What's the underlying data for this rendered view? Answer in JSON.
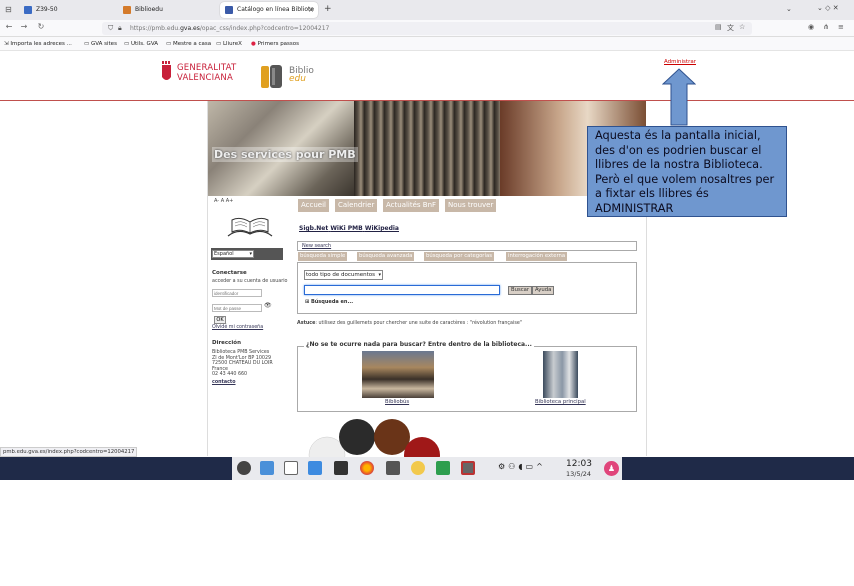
{
  "browser": {
    "tabs": [
      {
        "label": "Z39-50",
        "favicon_color": "#3a6bc4"
      },
      {
        "label": "Biblioedu",
        "favicon_color": "#d47a2a"
      },
      {
        "label": "Catálogo en línea Bibliote",
        "favicon_color": "#3a5aa8"
      }
    ],
    "new_tab": "+",
    "url_prefix": "https://pmb.edu.",
    "url_domain": "gva.es",
    "url_suffix": "/opac_css/index.php?codcentro=12004217",
    "bookmarks": [
      "Importa les adreces ...",
      "GVA sites",
      "Utils. GVA",
      "Mestre a casa",
      "LliureX",
      "Primers passos"
    ]
  },
  "header": {
    "gva_line1": "GENERALITAT",
    "gva_line2": "VALENCIANA",
    "biblio_name": "Biblio",
    "biblio_sub": "edu",
    "admin_link": "Administrar"
  },
  "banner": {
    "title": "Des services pour PMB"
  },
  "sidebar": {
    "font_size": "A- A A+",
    "language": "Español",
    "login_heading": "Conectarse",
    "login_hint": "acceder a su cuenta de usuario",
    "user_placeholder": "identificador",
    "pass_placeholder": "Mot de passe",
    "ok": "OK",
    "forgot": "Olvidé mi contraseña",
    "address_heading": "Dirección",
    "address_lines": [
      "Biblioteca PMB Services",
      "ZI de Mont'Lor BP 10029",
      "72500 CHATEAU DU LOIR",
      "France",
      "02 43 440 660"
    ],
    "contact": "contacto"
  },
  "nav_tabs": [
    "Accueil",
    "Calendrier",
    "Actualités BnF",
    "Nous trouver"
  ],
  "top_links": [
    "Sigb.Net",
    "WiKi PMB",
    "WiKipedia"
  ],
  "search": {
    "new_search": "New search",
    "tabs": [
      "búsqueda simple",
      "búsqueda avanzada",
      "búsqueda por categorías",
      "interrogación externa"
    ],
    "doc_type": "todo tipo de documentos",
    "search_btn": "Buscar",
    "help_btn": "Ayuda",
    "advanced": "Búsqueda en...",
    "tip_label": "Astuce",
    "tip_text": ": utilisez des guillemets pour chercher une suite de caractères : \"révolution française\""
  },
  "suggest": {
    "heading": "¿No se te ocurre nada para buscar? Entre dentro de la biblioteca...",
    "captions": [
      "Bibliobús",
      "Biblioteca principal"
    ]
  },
  "annotation": {
    "text": "Aquesta és la pantalla inicial, des d'on es podrien buscar el llibres de la nostra Biblioteca. Però el que volem nosaltres per a fixtar els llibres és ADMINISTRAR"
  },
  "status_url": "pmb.edu.gva.es/index.php?codcentro=12004217",
  "taskbar": {
    "time": "12:03",
    "date": "13/5/24"
  }
}
